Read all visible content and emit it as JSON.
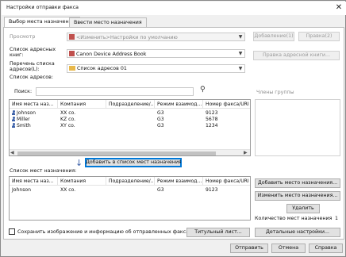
{
  "window": {
    "title": "Настройки отправки факса",
    "close_glyph": "✕"
  },
  "tabs": [
    {
      "label": "Выбор места назначения",
      "active": true
    },
    {
      "label": "Ввести место назначения",
      "active": false
    }
  ],
  "view": {
    "label": "Просмотр",
    "value": "<Изменить>Настройки по умолчанию",
    "add_button": "Добавление(1)",
    "edit_button": "Правка(2)"
  },
  "address_book": {
    "label": "Список адресных книг:",
    "value": "Canon Device Address Book",
    "open_button": "Правка адресной книги..."
  },
  "address_list": {
    "label": "Перечень списка адресов(L):",
    "value": "Список адресов 01",
    "list_label": "Список адресов:"
  },
  "search": {
    "label": "Поиск:",
    "value": "",
    "group_members_label": "Члены группы"
  },
  "columns": [
    "Имя места наз...",
    "Компания",
    "Подразделение/...",
    "Режим взаимод...",
    "Номер факса/URI"
  ],
  "address_rows": [
    {
      "name": "Johnson",
      "company": "XX co.",
      "dept": "",
      "mode": "G3",
      "fax": "9123"
    },
    {
      "name": "Miller",
      "company": "KZ co.",
      "dept": "",
      "mode": "G3",
      "fax": "5678"
    },
    {
      "name": "Smith",
      "company": "XY co.",
      "dept": "",
      "mode": "G3",
      "fax": "1234"
    }
  ],
  "add_to_list_button": "Добавить в список мест назначения(A)",
  "destinations": {
    "label": "Список мест назначения:",
    "rows": [
      {
        "name": "Johnson",
        "company": "XX co.",
        "dept": "",
        "mode": "G3",
        "fax": "9123"
      }
    ],
    "add_button": "Добавить место назначения...",
    "edit_button": "Изменить место назначения...",
    "delete_button": "Удалить",
    "count_label": "Количество мест назначения",
    "count_value": "1"
  },
  "save_checkbox_label": "Сохранить изображение и информацию об отправленных факсах",
  "cover_sheet_button": "Титульный лист...",
  "details_button": "Детальные настройки...",
  "footer": {
    "send": "Отправить",
    "cancel": "Отмена",
    "help": "Справка"
  },
  "colors": {
    "accent": "#0078d7",
    "user_icon": "#3a5fa8"
  }
}
